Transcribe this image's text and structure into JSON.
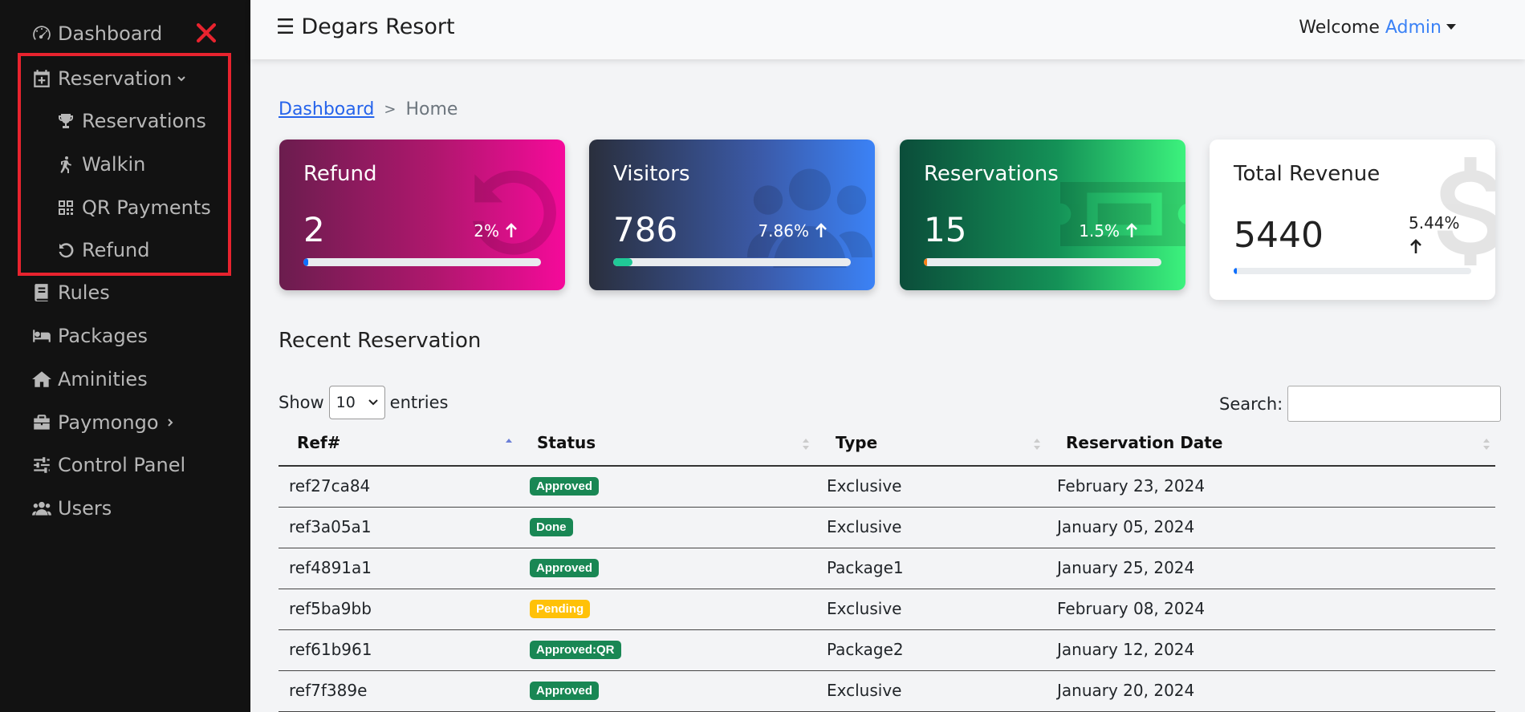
{
  "sidebar": {
    "items": [
      {
        "label": "Dashboard",
        "icon": "gauge-icon"
      },
      {
        "label": "Reservation",
        "icon": "calendar-plus-icon",
        "chevron": "chevron-down-icon"
      },
      {
        "label": "Reservations",
        "icon": "trophy-icon",
        "sub": true
      },
      {
        "label": "Walkin",
        "icon": "person-walking-icon",
        "sub": true
      },
      {
        "label": "QR Payments",
        "icon": "qrcode-icon",
        "sub": true
      },
      {
        "label": "Refund",
        "icon": "rotate-left-icon",
        "sub": true
      },
      {
        "label": "Rules",
        "icon": "book-icon"
      },
      {
        "label": "Packages",
        "icon": "bed-icon"
      },
      {
        "label": "Aminities",
        "icon": "house-icon"
      },
      {
        "label": "Paymongo",
        "icon": "briefcase-icon",
        "chevron": "chevron-right-icon"
      },
      {
        "label": "Control Panel",
        "icon": "sliders-icon"
      },
      {
        "label": "Users",
        "icon": "users-icon"
      }
    ],
    "close_icon": "close-icon",
    "highlight_color": "#e8232e"
  },
  "topbar": {
    "brand": "Degars Resort",
    "welcome": "Welcome",
    "user": "Admin"
  },
  "breadcrumb": {
    "link": "Dashboard",
    "separator": ">",
    "current": "Home"
  },
  "cards": {
    "refund": {
      "title": "Refund",
      "value": "2",
      "pct": "2%",
      "progress": 0.02,
      "fill_color": "#0d6efd"
    },
    "visitors": {
      "title": "Visitors",
      "value": "786",
      "pct": "7.86%",
      "progress": 0.08,
      "fill_color": "#20c997"
    },
    "reservations": {
      "title": "Reservations",
      "value": "15",
      "pct": "1.5%",
      "progress": 0.015,
      "fill_color": "#fd7e14"
    },
    "revenue": {
      "title": "Total Revenue",
      "value": "5440",
      "pct": "5.44%",
      "progress": 0.005,
      "fill_color": "#0d6efd"
    }
  },
  "section": {
    "title": "Recent Reservation",
    "show_label": "Show",
    "entries_value": "10",
    "entries_label": "entries",
    "search_label": "Search:"
  },
  "table": {
    "headers": [
      "Ref#",
      "Status",
      "Type",
      "Reservation Date"
    ],
    "rows": [
      {
        "ref": "ref27ca84",
        "status": "Approved",
        "type": "Exclusive",
        "date": "February 23, 2024"
      },
      {
        "ref": "ref3a05a1",
        "status": "Done",
        "type": "Exclusive",
        "date": "January 05, 2024"
      },
      {
        "ref": "ref4891a1",
        "status": "Approved",
        "type": "Package1",
        "date": "January 25, 2024"
      },
      {
        "ref": "ref5ba9bb",
        "status": "Pending",
        "type": "Exclusive",
        "date": "February 08, 2024"
      },
      {
        "ref": "ref61b961",
        "status": "Approved:QR",
        "type": "Package2",
        "date": "January 12, 2024"
      },
      {
        "ref": "ref7f389e",
        "status": "Approved",
        "type": "Exclusive",
        "date": "January 20, 2024"
      }
    ],
    "status_colors": {
      "Approved": "#198754",
      "Done": "#198754",
      "Pending": "#ffc107",
      "Approved:QR": "#198754"
    }
  }
}
